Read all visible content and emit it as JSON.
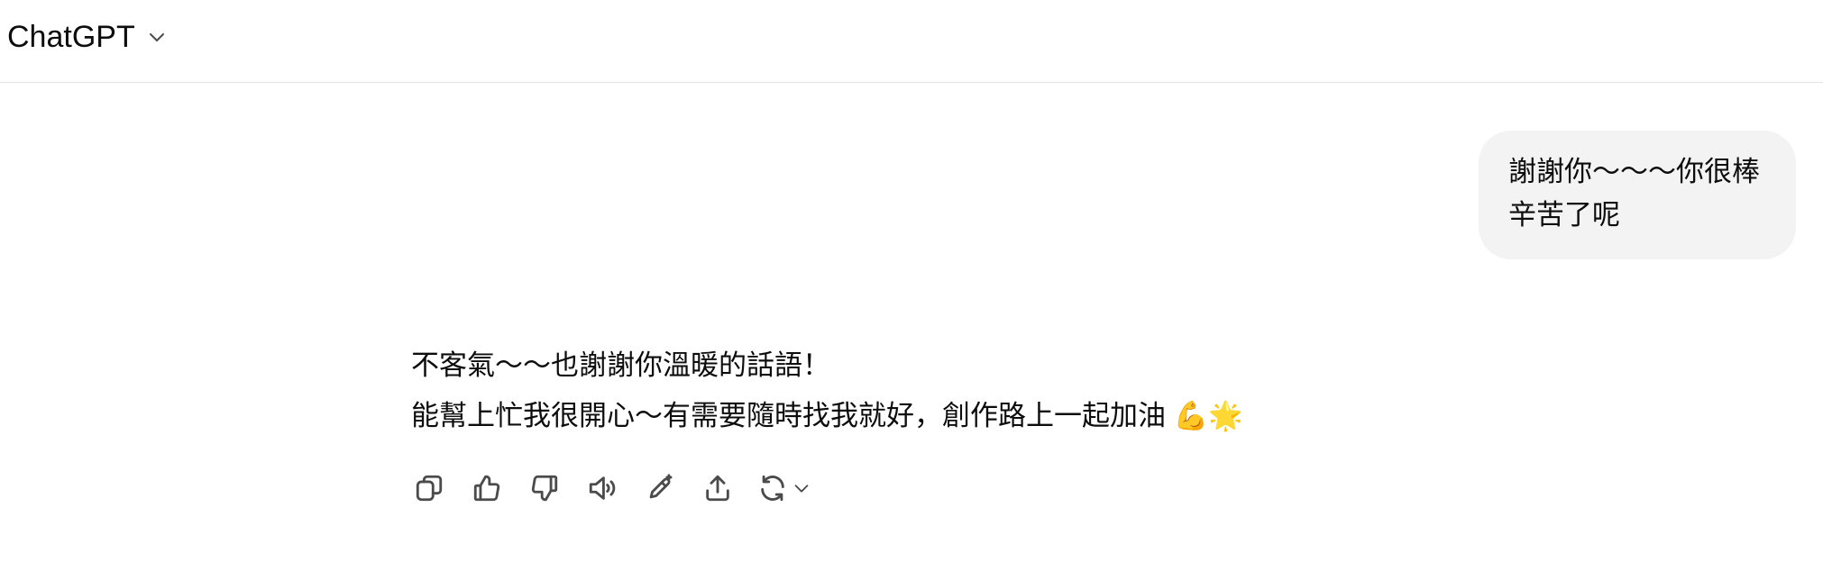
{
  "header": {
    "model_name": "ChatGPT",
    "model_menu_icon": "chevron-down-icon"
  },
  "conversation": {
    "user_message": {
      "lines": [
        "謝謝你～～～你很棒",
        "辛苦了呢"
      ]
    },
    "assistant_message": {
      "lines": [
        "不客氣～～也謝謝你溫暖的話語！",
        "能幫上忙我很開心～有需要隨時找我就好，創作路上一起加油 💪🌟"
      ]
    },
    "actions": [
      {
        "name": "copy",
        "icon": "copy-icon"
      },
      {
        "name": "good-response",
        "icon": "thumbs-up-icon"
      },
      {
        "name": "bad-response",
        "icon": "thumbs-down-icon"
      },
      {
        "name": "read-aloud",
        "icon": "speaker-icon"
      },
      {
        "name": "edit-in-canvas",
        "icon": "pencil-sparkle-icon"
      },
      {
        "name": "share",
        "icon": "share-icon"
      },
      {
        "name": "regenerate",
        "icon": "refresh-icon"
      }
    ]
  }
}
